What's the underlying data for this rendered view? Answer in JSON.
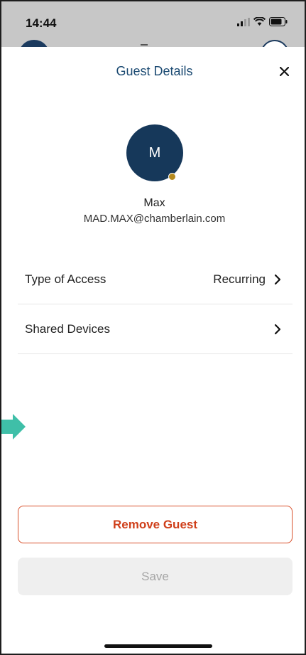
{
  "status_bar": {
    "time": "14:44"
  },
  "sheet": {
    "title": "Guest Details",
    "close_icon": "close-icon"
  },
  "guest": {
    "initial": "M",
    "name": "Max",
    "email": "MAD.MAX@chamberlain.com"
  },
  "rows": [
    {
      "label": "Type of Access",
      "value": "Recurring"
    },
    {
      "label": "Shared Devices",
      "value": ""
    }
  ],
  "buttons": {
    "remove": "Remove Guest",
    "save": "Save"
  },
  "colors": {
    "title": "#1b4a72",
    "avatar": "#16385a",
    "status_dot": "#b58a1f",
    "remove": "#cf3f1a",
    "pointer_arrow": "#3fbfa8"
  }
}
